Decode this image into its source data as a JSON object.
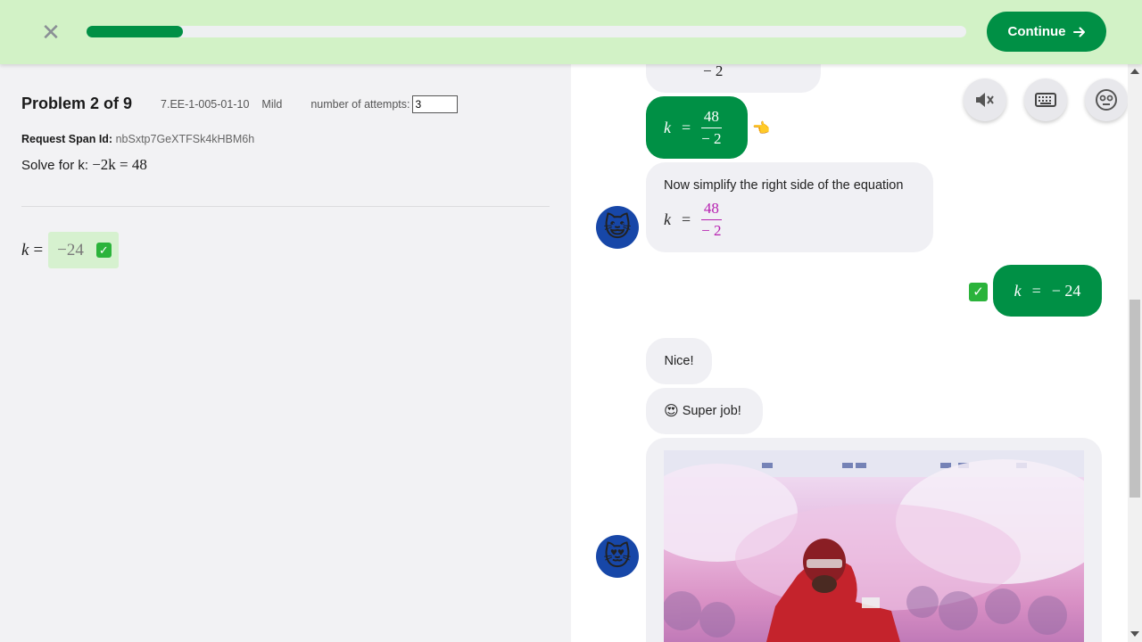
{
  "topbar": {
    "close_label": "✕",
    "progress_fraction": 0.11,
    "continue_label": "Continue"
  },
  "problem": {
    "title": "Problem 2 of 9",
    "code": "7.EE-1-005-01-10",
    "level": "Mild",
    "attempts_label": "number of attempts:",
    "attempts_value": "3",
    "span_label": "Request Span Id:",
    "span_value": "nbSxtp7GeXTFSk4kHBM6h",
    "solve_label": "Solve for k:",
    "equation": "−2k = 48",
    "answer_var": "k",
    "answer_eq": "=",
    "answer_value": "−24"
  },
  "chat": {
    "partial_fraction_den": "− 2",
    "user_answer_1": {
      "var": "k",
      "eq": "=",
      "num": "48",
      "den": "− 2"
    },
    "tutor_msg_1": "Now simplify the right side of the equation",
    "tutor_frac": {
      "var": "k",
      "eq": "=",
      "num": "48",
      "den": "− 2"
    },
    "user_answer_2": {
      "var": "k",
      "eq": "=",
      "value": "− 24"
    },
    "nice_msg": "Nice!",
    "super_msg": "Super job!",
    "pointer_emoji": "👈",
    "super_emoji": "😍",
    "cat_emoji": "😺",
    "cat_love_emoji": "😻"
  },
  "tools": {
    "mute_icon": "speaker-mute-icon",
    "keyboard_icon": "keyboard-icon",
    "face_icon": "face-icon"
  },
  "colors": {
    "accent": "#009045",
    "topbar_bg": "#d2f2c6",
    "math_magenta": "#b620b0",
    "avatar_bg": "#1747a8"
  }
}
